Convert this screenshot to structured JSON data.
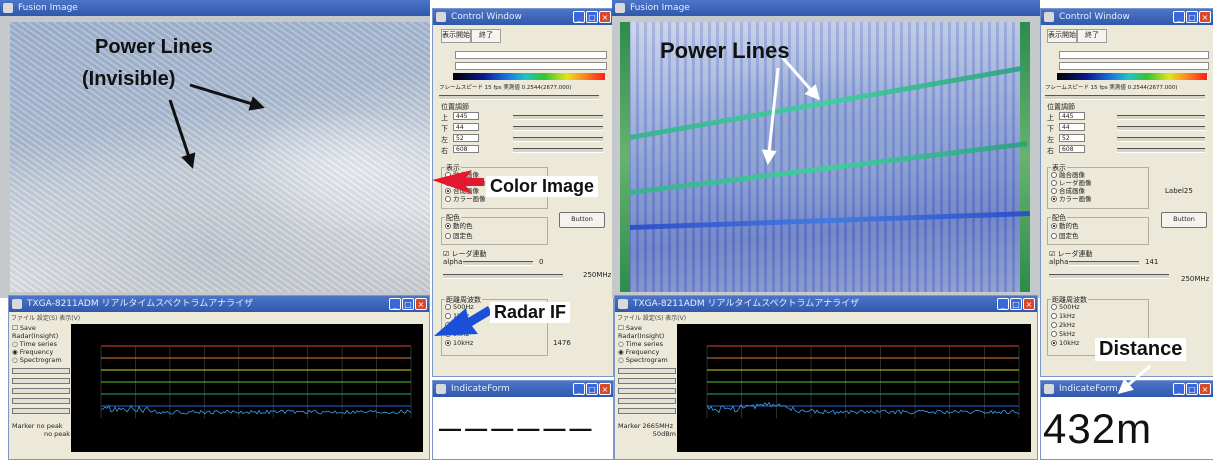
{
  "windows": {
    "fusion_left": {
      "title": "Fusion Image"
    },
    "fusion_right": {
      "title": "Fusion Image"
    },
    "control_left": {
      "title": "Control Window"
    },
    "control_right": {
      "title": "Control Window"
    },
    "spectrum_left": {
      "title": "TXGA-8211ADM リアルタイムスペクトラムアナライザ"
    },
    "spectrum_right": {
      "title": "TXGA-8211ADM リアルタイムスペクトラムアナライザ"
    },
    "indicate_left": {
      "title": "IndicateForm"
    },
    "indicate_right": {
      "title": "IndicateForm"
    }
  },
  "control_window": {
    "tabs": [
      "表示開始",
      "終了"
    ],
    "frame_speed_left": "フレームスピード 15 fps 実測値 0.2544(2677.000)",
    "frame_speed_right": "フレームスピード 15 fps 実測値 0.2544(2677.000)",
    "position_header": "位置調節",
    "position_rows": [
      {
        "label": "上",
        "value": "445"
      },
      {
        "label": "下",
        "value": "44"
      },
      {
        "label": "左",
        "value": "52"
      },
      {
        "label": "右",
        "value": "608"
      }
    ],
    "display_header": "表示",
    "display_options": [
      "融合画像",
      "レーダ画像",
      "合成画像",
      "カラー画像"
    ],
    "button_label": "Button",
    "coloring_header": "配色",
    "coloring_options": [
      "動的色",
      "固定色"
    ],
    "radar_link_label": "レーダ連動",
    "alpha_label": "alpha",
    "alpha_value_left": "0",
    "alpha_value_right": "141",
    "freq_value": "250MHz",
    "range_header": "距離周波数",
    "range_options": [
      "500Hz",
      "1kHz",
      "2kHz",
      "5kHz",
      "10kHz"
    ],
    "range_value_left": "1476",
    "right_side_label": "Label25"
  },
  "spectrum": {
    "menu": "ファイル 設定(S) 表示(V)",
    "options": [
      "Save",
      "Radar(Insight)",
      "Time series",
      "Frequency",
      "Spectrogram"
    ],
    "marker_left": "Marker no peak",
    "marker_left_2": "no peak",
    "marker_right": "Marker 2665MHz",
    "marker_right_2": "50dBm",
    "grid_colors": [
      "#d8442c",
      "#e07a2a",
      "#c9d31e",
      "#5bc92f",
      "#2f9e86",
      "#2a5fd8"
    ]
  },
  "indicate": {
    "left_value": "— — — — — —",
    "right_value": "432m"
  },
  "annotations": {
    "power_lines_left": "Power Lines",
    "invisible": "(Invisible)",
    "color_image": "Color Image",
    "radar_if": "Radar IF",
    "power_lines_right": "Power Lines",
    "distance": "Distance"
  },
  "colors": {
    "title_bar": "#3561b8",
    "arrow_red": "#e2182e",
    "arrow_blue": "#1a4fd8",
    "power_line_overlay": "#34c08f"
  }
}
